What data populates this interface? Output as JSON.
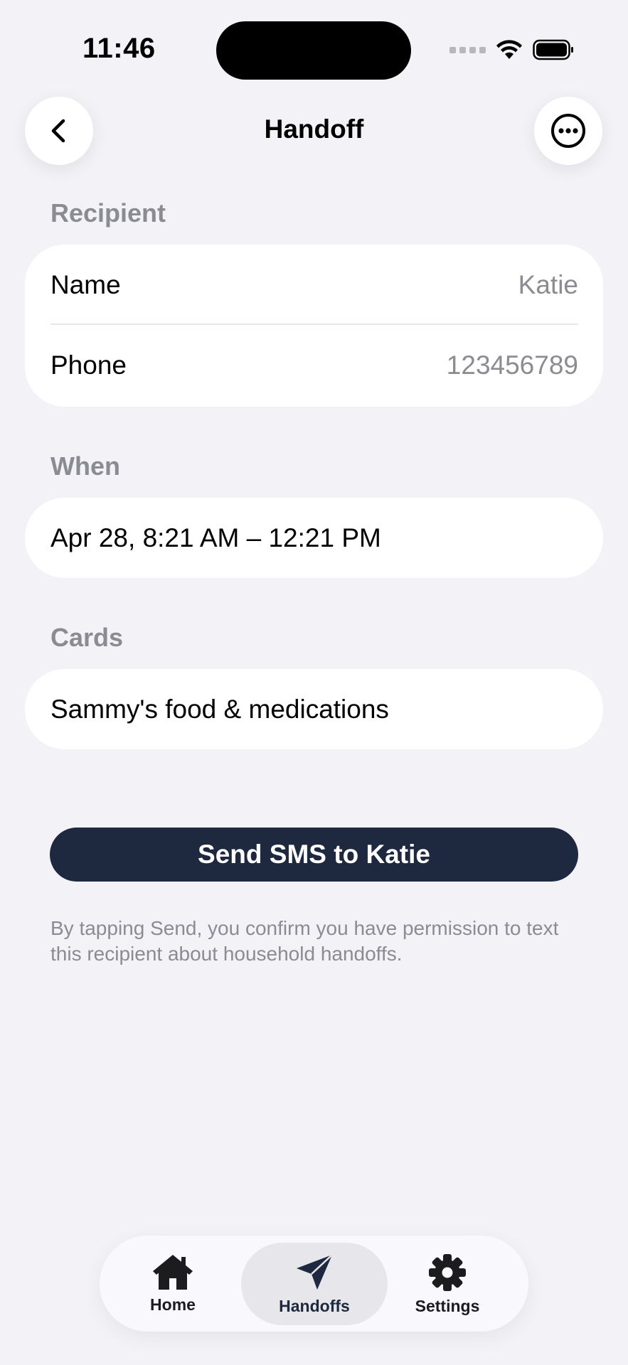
{
  "status_bar": {
    "time": "11:46"
  },
  "nav": {
    "title": "Handoff"
  },
  "recipient": {
    "section_label": "Recipient",
    "name_label": "Name",
    "name_value": "Katie",
    "phone_label": "Phone",
    "phone_value": "123456789"
  },
  "when": {
    "section_label": "When",
    "value": "Apr 28, 8:21 AM – 12:21 PM"
  },
  "cards": {
    "section_label": "Cards",
    "items": [
      "Sammy's food & medications"
    ]
  },
  "send_button": {
    "label": "Send SMS to Katie"
  },
  "disclaimer": "By tapping Send, you confirm you have permission to text this recipient about household handoffs.",
  "tab_bar": {
    "items": [
      {
        "label": "Home",
        "icon": "house-icon",
        "active": false
      },
      {
        "label": "Handoffs",
        "icon": "paper-plane-icon",
        "active": true
      },
      {
        "label": "Settings",
        "icon": "gear-icon",
        "active": false
      }
    ]
  },
  "colors": {
    "background": "#f2f2f7",
    "card": "#ffffff",
    "secondary_text": "#8b8b92",
    "accent": "#1e2940"
  }
}
